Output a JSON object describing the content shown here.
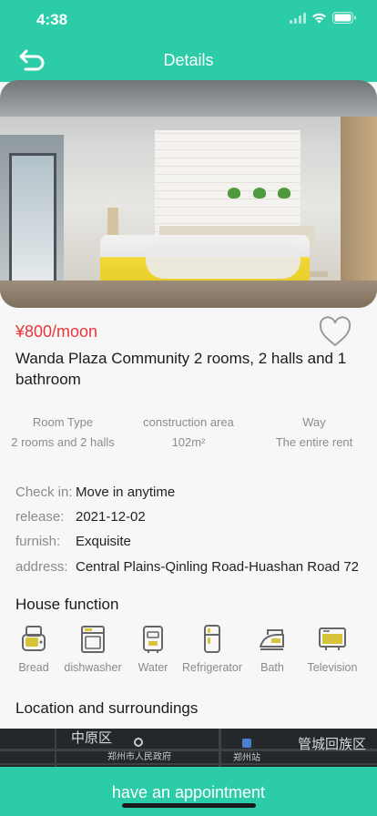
{
  "status_bar": {
    "time": "4:38"
  },
  "nav": {
    "title": "Details",
    "back_icon": "back-arrow-icon"
  },
  "listing": {
    "price": "¥800/moon",
    "title": "Wanda Plaza Community 2 rooms, 2 halls and 1 bathroom",
    "specs": [
      {
        "label": "Room Type",
        "value": "2 rooms and 2 halls"
      },
      {
        "label": "construction area",
        "value": "102m²"
      },
      {
        "label": "Way",
        "value": "The entire rent"
      }
    ],
    "info": [
      {
        "key": "Check in:",
        "value": "Move in anytime"
      },
      {
        "key": "release:",
        "value": "2021-12-02"
      },
      {
        "key": "furnish:",
        "value": "Exquisite"
      },
      {
        "key": "address:",
        "value": "Central Plains-Qinling Road-Huashan Road 72"
      }
    ]
  },
  "house_function": {
    "title": "House function",
    "items": [
      {
        "label": "Bread",
        "icon": "toaster-icon"
      },
      {
        "label": "dishwasher",
        "icon": "dishwasher-icon"
      },
      {
        "label": "Water",
        "icon": "water-heater-icon"
      },
      {
        "label": "Refrigerator",
        "icon": "refrigerator-icon"
      },
      {
        "label": "Bath",
        "icon": "iron-icon"
      },
      {
        "label": "Television",
        "icon": "television-icon"
      }
    ]
  },
  "location": {
    "title": "Location and surroundings",
    "map_labels": [
      "中原区",
      "管城回族区",
      "郑州市人民政府",
      "郑州站"
    ]
  },
  "cta": {
    "label": "have an appointment"
  },
  "colors": {
    "accent": "#2dcca8",
    "price": "#e8363d",
    "icon_yellow": "#d7c43a"
  }
}
